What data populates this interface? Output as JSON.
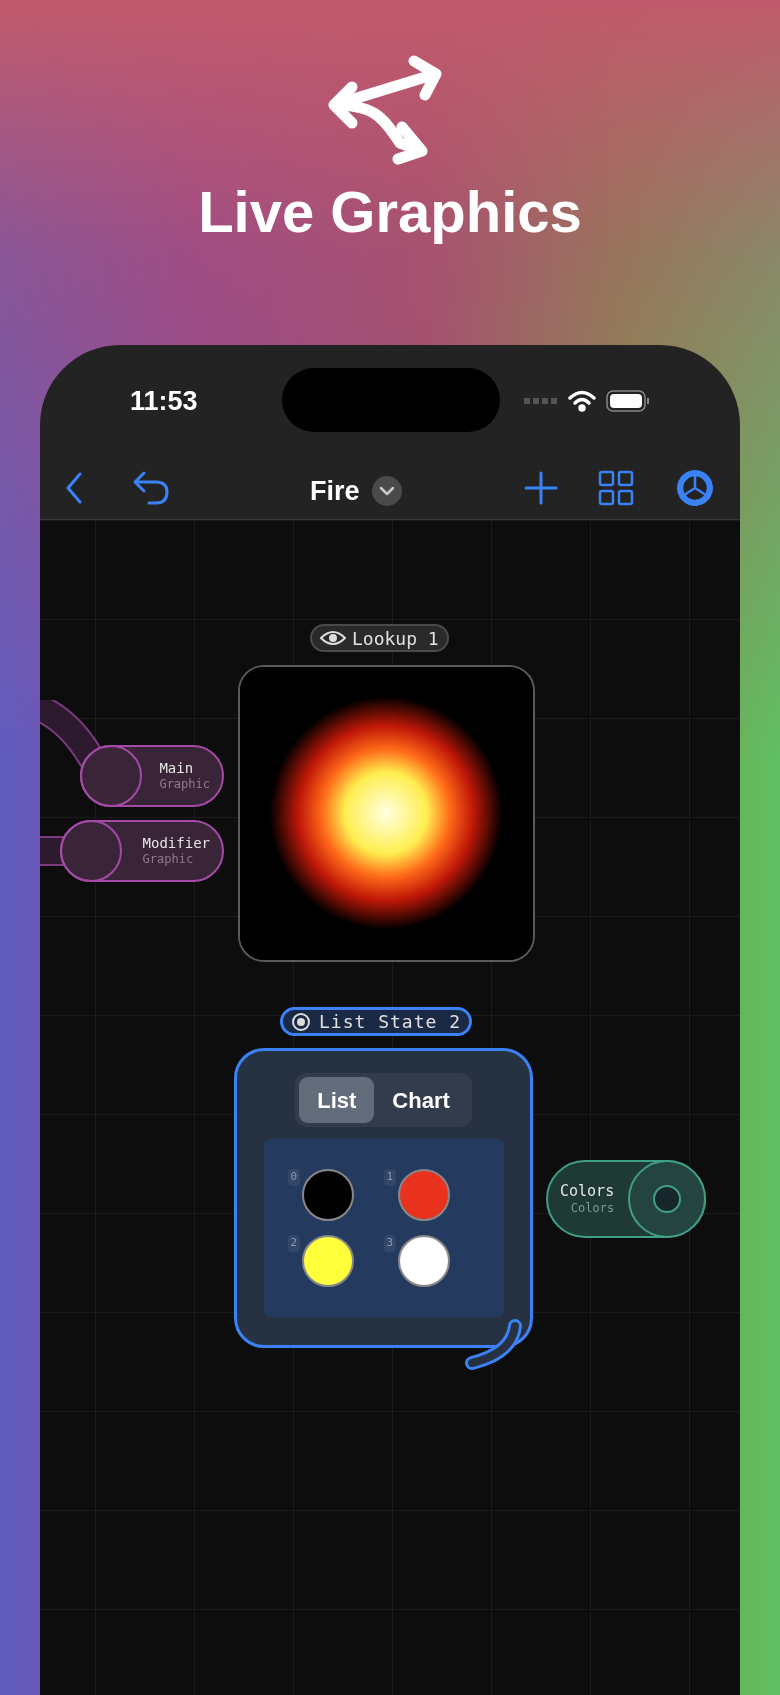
{
  "headline": "Live Graphics",
  "status_bar": {
    "time": "11:53"
  },
  "nav_bar": {
    "title": "Fire"
  },
  "preview_node": {
    "label": "Lookup 1",
    "selected": false
  },
  "input_ports": [
    {
      "name": "Main",
      "type": "Graphic"
    },
    {
      "name": "Modifier",
      "type": "Graphic"
    }
  ],
  "list_node": {
    "label": "List State 2",
    "selected": true,
    "tabs": [
      {
        "label": "List",
        "selected": true
      },
      {
        "label": "Chart",
        "selected": false
      }
    ],
    "swatches": [
      {
        "index": "0",
        "color": "#000000"
      },
      {
        "index": "1",
        "color": "#e8321e"
      },
      {
        "index": "2",
        "color": "#ffff3c"
      },
      {
        "index": "3",
        "color": "#ffffff"
      }
    ]
  },
  "output_port": {
    "name": "Colors",
    "type": "Colors"
  }
}
